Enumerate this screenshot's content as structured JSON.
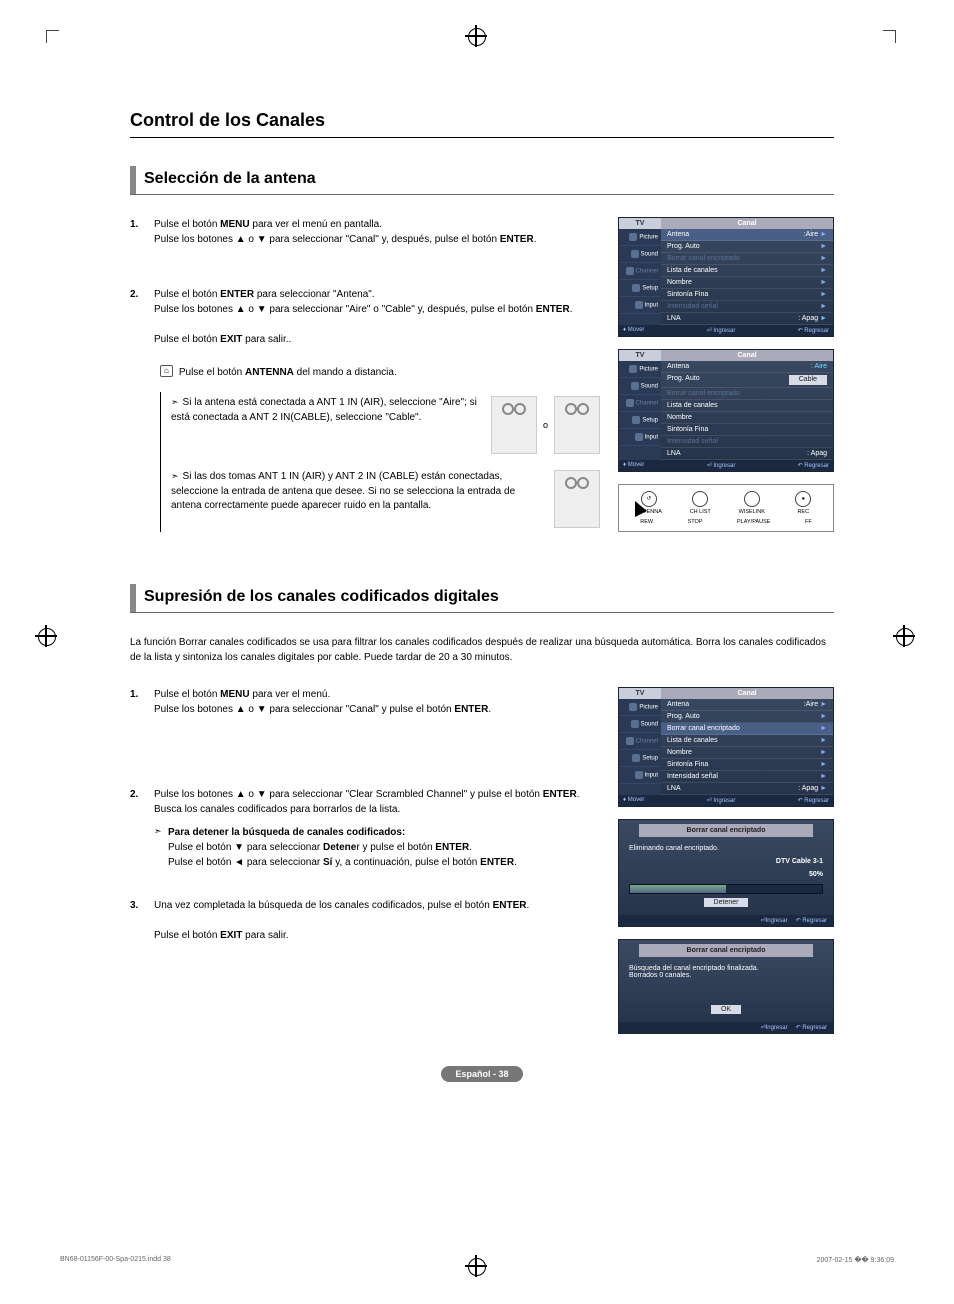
{
  "header": {
    "main": "Control de los Canales"
  },
  "sec1": {
    "title": "Selección de la antena",
    "step1": "Pulse el botón MENU para ver el menú en pantalla.\nPulse los botones ▲ o ▼ para seleccionar \"Canal\" y, después, pulse el botón ENTER.",
    "step2a": "Pulse el botón ENTER para seleccionar \"Antena\".\nPulse los botones ▲ o ▼ para seleccionar \"Aire\" o \"Cable\" y, después, pulse el botón ENTER.",
    "step2b": "Pulse el botón EXIT para salir..",
    "remote_note": "Pulse el botón ANTENNA del mando a distancia.",
    "hint1": "Si la antena está conectada a ANT 1 IN (AIR), seleccione \"Aire\"; si está conectada a ANT 2 IN(CABLE), seleccione \"Cable\".",
    "hint_or": "o",
    "hint2": "Si las dos tomas ANT 1 IN (AIR) y ANT 2 IN (CABLE) están conectadas, seleccione la entrada de antena que desee. Si no se selecciona la entrada de antena correctamente puede aparecer ruido en la pantalla."
  },
  "sec2": {
    "title": "Supresión de los canales codificados digitales",
    "intro": "La función Borrar canales codificados se usa para filtrar los canales codificados después de realizar una búsqueda automática. Borra los canales codificados de la lista y sintoniza los canales digitales por cable. Puede tardar de 20 a 30 minutos.",
    "step1": "Pulse el botón MENU para ver el menú.\nPulse los botones ▲ o ▼ para seleccionar \"Canal\" y pulse el botón ENTER.",
    "step2": "Pulse los botones ▲ o ▼ para seleccionar \"Clear Scrambled Channel\" y pulse el botón ENTER. Busca los canales codificados para borrarlos de la lista.",
    "step2_hint_title": "Para detener la búsqueda de canales codificados:",
    "step2_hint": "Pulse el botón ▼ para seleccionar Detener y pulse el botón ENTER.\nPulse el botón ◄ para seleccionar Sí y, a continuación, pulse el botón ENTER.",
    "step3a": "Una vez completada la búsqueda de los canales codificados, pulse el botón ENTER.",
    "step3b": "Pulse el botón EXIT para salir."
  },
  "osd": {
    "tv": "TV",
    "title": "Canal",
    "side": [
      "Picture",
      "Sound",
      "Channel",
      "Setup",
      "Input"
    ],
    "items": {
      "antena": "Antena",
      "antena_val": ":Aire",
      "prog": "Prog. Auto",
      "borrar": "Borrar canal encriptado",
      "lista": "Lista de canales",
      "nombre": "Nombre",
      "sint": "Sintonía Fina",
      "intens": "Intensidad señal",
      "lna": "LNA",
      "lna_val": ": Apag"
    },
    "dropdown": {
      "aire": "Aire",
      "cable": "Cable"
    },
    "foot": {
      "mover": "Mover",
      "ingresar": "Ingresar",
      "regresar": "Regresar"
    }
  },
  "remote": {
    "antenna": "ANTENNA",
    "chlist": "CH LIST",
    "wiselink": "WISELINK",
    "rec": "REC",
    "rew": "REW",
    "stop": "STOP",
    "play": "PLAY/PAUSE",
    "ff": "FF"
  },
  "modal1": {
    "title": "Borrar canal encriptado",
    "line": "Eliminando canal encriptado.",
    "ch": "DTV Cable 3-1",
    "pct": "50%",
    "pct_val": 50,
    "btn": "Detener"
  },
  "modal2": {
    "title": "Borrar canal encriptado",
    "line1": "Búsqueda del canal encriptado finalizada.",
    "line2": "Borrados 0 canales.",
    "btn": "OK"
  },
  "pill": "Español - 38",
  "footer": {
    "left": "BN68-01156F-00-Spa-0215.indd   38",
    "right": "2007-02-15   �� 9:36:09"
  }
}
